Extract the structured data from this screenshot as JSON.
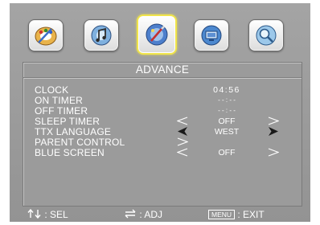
{
  "toolbar": {
    "icons": [
      {
        "name": "picture-palette-icon",
        "selected": false
      },
      {
        "name": "audio-music-icon",
        "selected": false
      },
      {
        "name": "advance-settings-icon",
        "selected": true
      },
      {
        "name": "tv-channel-icon",
        "selected": false
      },
      {
        "name": "search-magnifier-icon",
        "selected": false
      }
    ]
  },
  "menu": {
    "title": "ADVANCE",
    "items": [
      {
        "label": "CLOCK",
        "value": "04:56"
      },
      {
        "label": "ON TIMER",
        "value": "- - : - -"
      },
      {
        "label": "OFF TIMER",
        "value": "- - : - -"
      },
      {
        "label": "SLEEP TIMER",
        "value": "OFF"
      },
      {
        "label": "TTX LANGUAGE",
        "value": "WEST"
      },
      {
        "label": "PARENT CONTROL",
        "value": ""
      },
      {
        "label": "BLUE SCREEN",
        "value": "OFF"
      }
    ]
  },
  "footer": {
    "select_label": ": SEL",
    "adjust_label": ": ADJ",
    "menu_key": "MENU",
    "exit_label": ": EXIT"
  },
  "colors": {
    "background": "#9b9b9b",
    "text": "#ffffff",
    "selected_icon_border": "#f0e44a"
  }
}
